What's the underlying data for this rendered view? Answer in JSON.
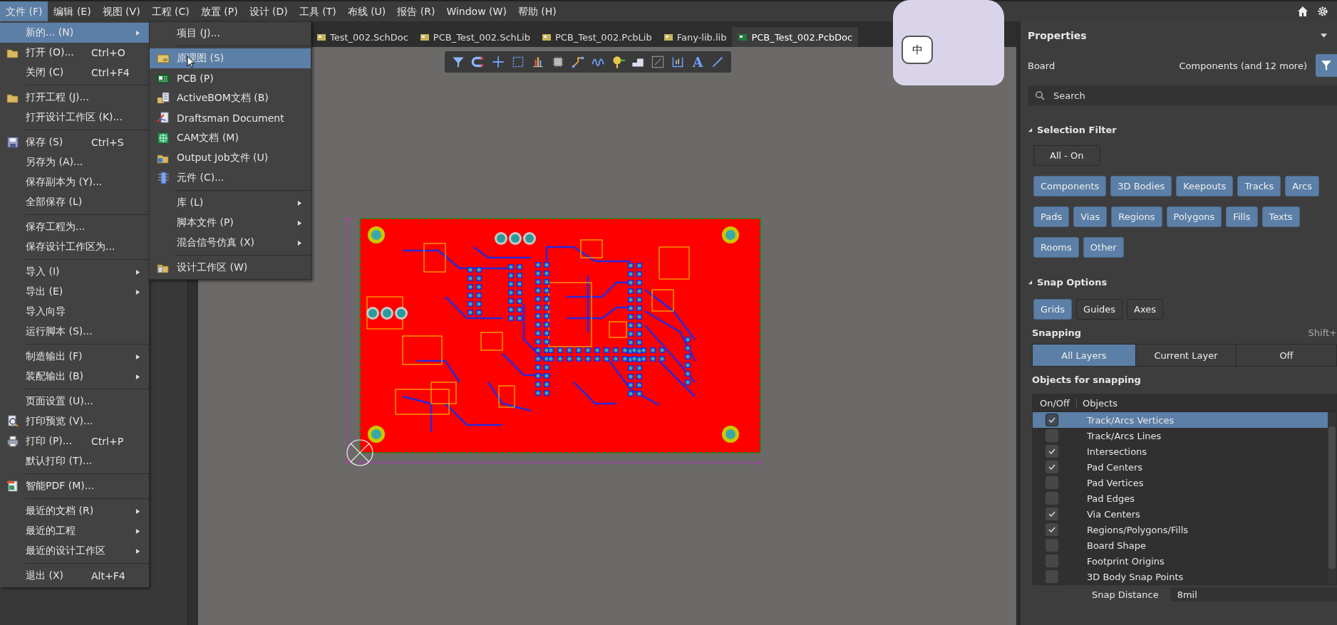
{
  "menu_bar": {
    "items": [
      {
        "label": "文件 (F)",
        "selected": true
      },
      {
        "label": "编辑 (E)",
        "selected": false
      },
      {
        "label": "视图 (V)",
        "selected": false
      },
      {
        "label": "工程 (C)",
        "selected": false
      },
      {
        "label": "放置 (P)",
        "selected": false
      },
      {
        "label": "设计 (D)",
        "selected": false
      },
      {
        "label": "工具 (T)",
        "selected": false
      },
      {
        "label": "布线 (U)",
        "selected": false
      },
      {
        "label": "报告 (R)",
        "selected": false
      },
      {
        "label": "Window (W)",
        "selected": false
      },
      {
        "label": "帮助 (H)",
        "selected": false
      }
    ]
  },
  "file_menu": {
    "sections": [
      [
        {
          "label": "新的... (N)",
          "submenu": true,
          "selected": true
        },
        {
          "label": "打开 (O)...",
          "shortcut": "Ctrl+O",
          "submenu": false,
          "selected": false
        },
        {
          "label": "关闭 (C)",
          "shortcut": "Ctrl+F4",
          "submenu": false,
          "selected": false
        }
      ],
      [
        {
          "label": "打开工程 (J)...",
          "submenu": false,
          "selected": false
        },
        {
          "label": "打开设计工作区 (K)...",
          "submenu": false,
          "selected": false
        }
      ],
      [
        {
          "label": "保存 (S)",
          "shortcut": "Ctrl+S",
          "submenu": false,
          "selected": false
        },
        {
          "label": "另存为 (A)...",
          "submenu": false,
          "selected": false
        },
        {
          "label": "保存副本为 (Y)...",
          "submenu": false,
          "selected": false
        },
        {
          "label": "全部保存 (L)",
          "submenu": false,
          "selected": false
        }
      ],
      [
        {
          "label": "保存工程为...",
          "submenu": false,
          "selected": false
        },
        {
          "label": "保存设计工作区为...",
          "submenu": false,
          "selected": false
        }
      ],
      [
        {
          "label": "导入 (I)",
          "submenu": true,
          "selected": false
        },
        {
          "label": "导出 (E)",
          "submenu": true,
          "selected": false
        },
        {
          "label": "导入向导",
          "submenu": false,
          "selected": false
        },
        {
          "label": "运行脚本 (S)...",
          "submenu": false,
          "selected": false
        }
      ],
      [
        {
          "label": "制造输出 (F)",
          "submenu": true,
          "selected": false
        },
        {
          "label": "装配输出 (B)",
          "submenu": true,
          "selected": false
        }
      ],
      [
        {
          "label": "页面设置 (U)...",
          "submenu": false,
          "selected": false
        },
        {
          "label": "打印预览 (V)...",
          "submenu": false,
          "selected": false
        },
        {
          "label": "打印 (P)...",
          "shortcut": "Ctrl+P",
          "submenu": false,
          "selected": false
        },
        {
          "label": "默认打印 (T)...",
          "submenu": false,
          "selected": false
        }
      ],
      [
        {
          "label": "智能PDF (M)...",
          "submenu": false,
          "selected": false
        }
      ],
      [
        {
          "label": "最近的文档 (R)",
          "submenu": true,
          "selected": false
        },
        {
          "label": "最近的工程",
          "submenu": true,
          "selected": false
        },
        {
          "label": "最近的设计工作区",
          "submenu": true,
          "selected": false
        }
      ],
      [
        {
          "label": "退出 (X)",
          "shortcut": "Alt+F4",
          "submenu": false,
          "selected": false
        }
      ]
    ]
  },
  "new_submenu": {
    "sections": [
      [
        {
          "label": "项目 (J)...",
          "submenu": false,
          "selected": false
        }
      ],
      [
        {
          "label": "原理图 (S)",
          "submenu": false,
          "selected": true
        },
        {
          "label": "PCB (P)",
          "submenu": false,
          "selected": false
        },
        {
          "label": "ActiveBOM文档 (B)",
          "submenu": false,
          "selected": false
        },
        {
          "label": "Draftsman Document",
          "submenu": false,
          "selected": false
        },
        {
          "label": "CAM文档 (M)",
          "submenu": false,
          "selected": false
        },
        {
          "label": "Output Job文件 (U)",
          "submenu": false,
          "selected": false
        },
        {
          "label": "元件 (C)...",
          "submenu": false,
          "selected": false
        }
      ],
      [
        {
          "label": "库 (L)",
          "submenu": true,
          "selected": false
        },
        {
          "label": "脚本文件 (P)",
          "submenu": true,
          "selected": false
        },
        {
          "label": "混合信号仿真 (X)",
          "submenu": true,
          "selected": false
        }
      ],
      [
        {
          "label": "设计工作区 (W)",
          "submenu": false,
          "selected": false
        }
      ]
    ]
  },
  "document_tabs": [
    {
      "label": "Test_002.SchDoc",
      "selected": false
    },
    {
      "label": "PCB_Test_002.SchLib",
      "selected": false
    },
    {
      "label": "PCB_Test_002.PcbLib",
      "selected": false
    },
    {
      "label": "Fany-lib.lib",
      "selected": false
    },
    {
      "label": "PCB_Test_002.PcbDoc",
      "selected": true
    }
  ],
  "toolbar": {
    "text_tool_label": "A"
  },
  "ime_indicator": "中",
  "properties": {
    "title": "Properties",
    "object": "Board",
    "filter_summary": "Components (and 12 more)",
    "search": {
      "placeholder": "Search"
    },
    "selection_filter": {
      "title": "Selection Filter",
      "expanded": true,
      "all_button": "All - On",
      "items": [
        {
          "label": "Components",
          "on": true
        },
        {
          "label": "3D Bodies",
          "on": true
        },
        {
          "label": "Keepouts",
          "on": true
        },
        {
          "label": "Tracks",
          "on": true
        },
        {
          "label": "Arcs",
          "on": true
        },
        {
          "label": "Pads",
          "on": true
        },
        {
          "label": "Vias",
          "on": true
        },
        {
          "label": "Regions",
          "on": true
        },
        {
          "label": "Polygons",
          "on": true
        },
        {
          "label": "Fills",
          "on": true
        },
        {
          "label": "Texts",
          "on": true
        },
        {
          "label": "Rooms",
          "on": true
        },
        {
          "label": "Other",
          "on": true
        }
      ]
    },
    "snap_options": {
      "title": "Snap Options",
      "expanded": true,
      "guides": [
        {
          "label": "Grids",
          "on": true
        },
        {
          "label": "Guides",
          "on": false
        },
        {
          "label": "Axes",
          "on": false
        }
      ],
      "snapping_label": "Snapping",
      "snapping_shortcut": "Shift+",
      "snapping_modes": [
        {
          "label": "All Layers",
          "selected": true
        },
        {
          "label": "Current Layer",
          "selected": false
        },
        {
          "label": "Off",
          "selected": false
        }
      ],
      "objects_title": "Objects for snapping",
      "columns": [
        "On/Off",
        "Objects"
      ],
      "objects": [
        {
          "label": "Track/Arcs Vertices",
          "checked": true,
          "selected": true
        },
        {
          "label": "Track/Arcs Lines",
          "checked": false,
          "selected": false
        },
        {
          "label": "Intersections",
          "checked": true,
          "selected": false
        },
        {
          "label": "Pad Centers",
          "checked": true,
          "selected": false
        },
        {
          "label": "Pad Vertices",
          "checked": false,
          "selected": false
        },
        {
          "label": "Pad Edges",
          "checked": false,
          "selected": false
        },
        {
          "label": "Via Centers",
          "checked": true,
          "selected": false
        },
        {
          "label": "Regions/Polygons/Fills",
          "checked": true,
          "selected": false
        },
        {
          "label": "Board Shape",
          "checked": false,
          "selected": false
        },
        {
          "label": "Footprint Origins",
          "checked": false,
          "selected": false
        },
        {
          "label": "3D Body Snap Points",
          "checked": false,
          "selected": false
        }
      ],
      "snap_distance": {
        "label": "Snap Distance",
        "value": "8mil"
      }
    }
  }
}
